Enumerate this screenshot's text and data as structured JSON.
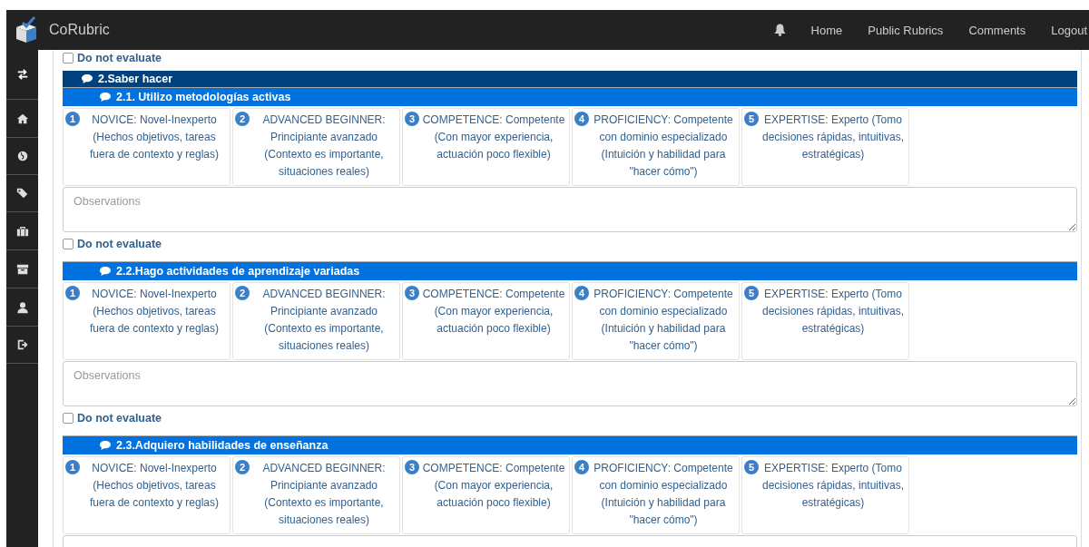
{
  "navbar": {
    "brand": "CoRubric",
    "links": [
      "Home",
      "Public Rubrics",
      "Comments",
      "Logout"
    ]
  },
  "previous_do_not_evaluate": {
    "label": "Do not evaluate",
    "checked": false
  },
  "section": {
    "title": "2.Saber hacer",
    "criteria": [
      {
        "title": "2.1. Utilizo metodologías activas",
        "levels": [
          {
            "number": "1",
            "text": "NOVICE: Novel-Inexperto (Hechos objetivos, tareas fuera de contexto y reglas)"
          },
          {
            "number": "2",
            "text": "ADVANCED BEGINNER: Principiante avanzado (Contexto es importante, situaciones reales)"
          },
          {
            "number": "3",
            "text": "COMPETENCE: Competente (Con mayor experiencia, actuación poco flexible)"
          },
          {
            "number": "4",
            "text": "PROFICIENCY: Competente con dominio especializado (Intuición y habilidad para \"hacer cómo\")"
          },
          {
            "number": "5",
            "text": "EXPERTISE: Experto (Tomo decisiones rápidas, intuitivas, estratégicas)"
          }
        ],
        "observations": {
          "placeholder": "Observations"
        },
        "do_not_evaluate": {
          "label": "Do not evaluate",
          "checked": false
        }
      },
      {
        "title": "2.2.Hago actividades de aprendizaje variadas",
        "levels": [
          {
            "number": "1",
            "text": "NOVICE: Novel-Inexperto (Hechos objetivos, tareas fuera de contexto y reglas)"
          },
          {
            "number": "2",
            "text": "ADVANCED BEGINNER: Principiante avanzado (Contexto es importante, situaciones reales)"
          },
          {
            "number": "3",
            "text": "COMPETENCE: Competente (Con mayor experiencia, actuación poco flexible)"
          },
          {
            "number": "4",
            "text": "PROFICIENCY: Competente con dominio especializado (Intuición y habilidad para \"hacer cómo\")"
          },
          {
            "number": "5",
            "text": "EXPERTISE: Experto (Tomo decisiones rápidas, intuitivas, estratégicas)"
          }
        ],
        "observations": {
          "placeholder": "Observations"
        },
        "do_not_evaluate": {
          "label": "Do not evaluate",
          "checked": false
        }
      },
      {
        "title": "2.3.Adquiero habilidades de enseñanza",
        "levels": [
          {
            "number": "1",
            "text": "NOVICE: Novel-Inexperto (Hechos objetivos, tareas fuera de contexto y reglas)"
          },
          {
            "number": "2",
            "text": "ADVANCED BEGINNER: Principiante avanzado (Contexto es importante, situaciones reales)"
          },
          {
            "number": "3",
            "text": "COMPETENCE: Competente (Con mayor experiencia, actuación poco flexible)"
          },
          {
            "number": "4",
            "text": "PROFICIENCY: Competente con dominio especializado (Intuición y habilidad para \"hacer cómo\")"
          },
          {
            "number": "5",
            "text": "EXPERTISE: Experto (Tomo decisiones rápidas, intuitivas, estratégicas)"
          }
        ],
        "observations_shown": true
      }
    ]
  }
}
